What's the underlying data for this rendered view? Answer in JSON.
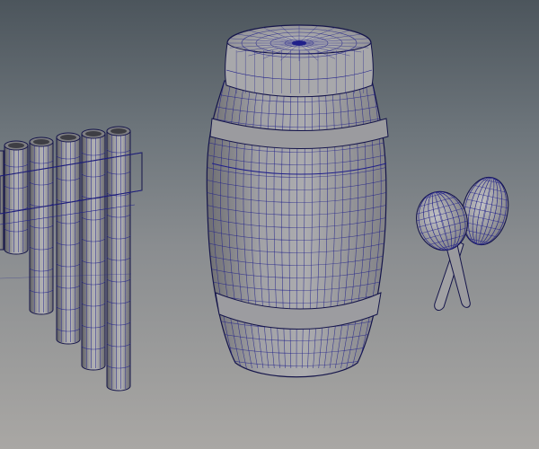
{
  "viewport": {
    "background_top": "#4c555c",
    "background_bottom": "#a9a7a4",
    "mesh_fill": "#8f8f91",
    "mesh_fill_light": "#bdbdc0",
    "mesh_fill_dark": "#5e5e62",
    "wire_color": "#20208a",
    "outline_color": "#15154a"
  },
  "scene": {
    "objects": [
      "pan-flute",
      "barrel-drum",
      "maracas"
    ]
  }
}
